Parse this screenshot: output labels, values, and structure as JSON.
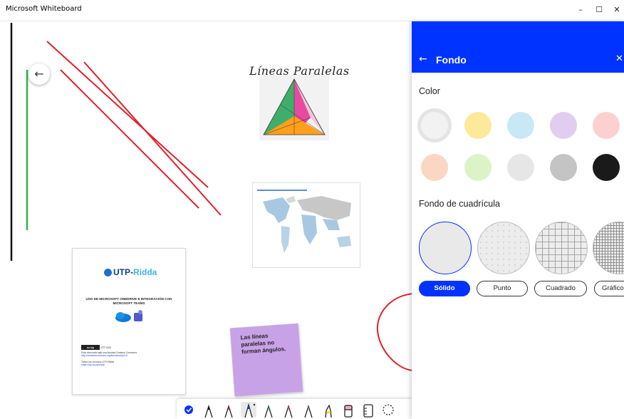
{
  "window": {
    "title": "Microsoft Whiteboard",
    "minimize": "–",
    "maximize": "☐",
    "close": "✕"
  },
  "canvas": {
    "back_glyph": "←",
    "board_title": "Líneas Paralelas",
    "document": {
      "logo_primary": "UTP-",
      "logo_accent": "Ridda",
      "heading": "USO DE MICROSOFT ONEDRIVE E INTEGRACIÓN CON MICROSOFT TEAMS",
      "cc_badge": "cc by",
      "year": "UTP 2020",
      "small_text": "Esta obra está bajo una licencia Creative Commons",
      "link_text": "http://creativecommons.org/licenses/by/4.0/",
      "footer": "Todos los recursos UTP-Ridda",
      "footer_link": "https://utp.ac.pa/ridda"
    },
    "sticky_note": "Las líneas paralelas no forman ángulos."
  },
  "toolbar": {
    "tools": [
      "check-tool",
      "pen-black",
      "pen-red",
      "pen-blue",
      "pen-green",
      "pen-pink",
      "pen-gray",
      "highlighter-yellow",
      "eraser",
      "ruler",
      "lasso"
    ]
  },
  "panel": {
    "back_glyph": "←",
    "title": "Fondo",
    "close_glyph": "✕",
    "color_label": "Color",
    "grid_label": "Fondo de cuadrícula",
    "colors": [
      "#f2f2f2",
      "#fde99a",
      "#c9e8f6",
      "#e1cdef",
      "#fdd0d0",
      "#fbd6c3",
      "#dcf3c8",
      "#e6e6e6",
      "#c4c4c4",
      "#1a1a1a"
    ],
    "grid_options": [
      "Sólido",
      "Punto",
      "Cuadrado",
      "Gráfico"
    ]
  },
  "colors": {
    "accent": "#0033ff",
    "sticky": "#c8a2e6"
  }
}
